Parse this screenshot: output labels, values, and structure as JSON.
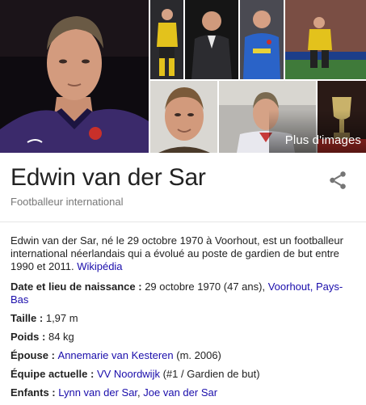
{
  "more_images_label": "Plus d'images",
  "title": "Edwin van der Sar",
  "subtitle": "Footballeur international",
  "description": {
    "text": "Edwin van der Sar, né le 29 octobre 1970 à Voorhout, est un footballeur international néerlandais qui a évolué au poste de gardien de but entre 1990 et 2011.",
    "source_link": "Wikipédia"
  },
  "facts": {
    "birth": {
      "label": "Date et lieu de naissance",
      "date": "29 octobre 1970 (47 ans)",
      "place_link": "Voorhout, Pays-Bas"
    },
    "height": {
      "label": "Taille",
      "value": "1,97 m"
    },
    "weight": {
      "label": "Poids",
      "value": "84 kg"
    },
    "spouse": {
      "label": "Épouse",
      "link": "Annemarie van Kesteren",
      "extra": "(m. 2006)"
    },
    "team": {
      "label": "Équipe actuelle",
      "link": "VV Noordwijk",
      "extra": "(#1 / Gardien de but)"
    },
    "children": {
      "label": "Enfants",
      "link1": "Lynn van der Sar",
      "link2": "Joe van der Sar"
    }
  },
  "colors": {
    "link": "#1a0dab",
    "text": "#222222",
    "muted": "#777777",
    "kit_purple": "#3b2a6b",
    "kit_yellow": "#e3c21c",
    "kit_blue": "#2a63c8"
  },
  "icons": {
    "share": "share-icon"
  }
}
